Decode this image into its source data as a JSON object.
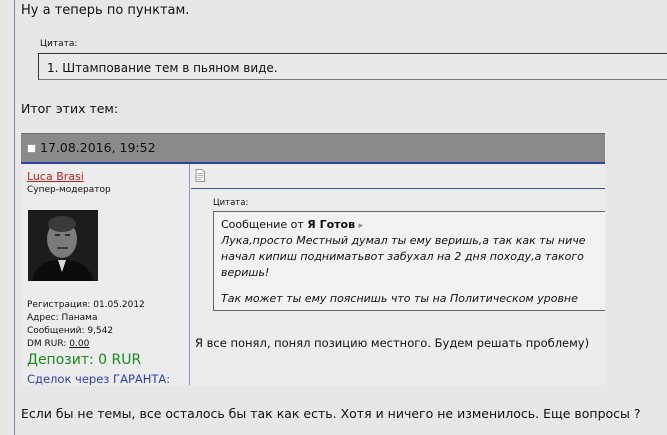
{
  "post": {
    "intro": "Ну а теперь по пунктам.",
    "quote1": {
      "label": "Цитата:",
      "text": "1. Штампование тем в пьяном виде."
    },
    "itog": "Итог этих тем:",
    "bottom": "Если бы не темы, все осталось бы так как есть. Хотя и ничего не изменилось. Еще вопросы ?"
  },
  "screenshot": {
    "date": "17.08.2016, 19:52",
    "user": {
      "name": "Luca Brasi",
      "title": "Супер-модератор",
      "reg": "Регистрация: 01.05.2012",
      "address": "Адрес: Панама",
      "posts": "Сообщений: 9,542",
      "dm_label": "DM RUR:",
      "dm_value": "0.00",
      "deposit": "Депозит: 0 RUR",
      "sdelok": "Сделок через ГАРАНТА:"
    },
    "quote2": {
      "label": "Цитата:",
      "from_prefix": "Сообщение от",
      "author": "Я Готов",
      "line1": "Лука,просто Местный думал ты ему веришь,а так как ты ниче",
      "line2": "начал кипиш подниматьвот забухал на 2 дня походу,а такого",
      "line3": "веришь!",
      "line4": "Так может ты ему пояснишь что ты на Политическом уровне"
    },
    "reply": "Я все понял, понял позицию местного. Будем решать проблему)"
  },
  "colors": {
    "background": "#e7e7e7",
    "header": "#8a8a8a",
    "username": "#b22222",
    "deposit": "#1a8a1a",
    "link": "#2b3fb8"
  }
}
